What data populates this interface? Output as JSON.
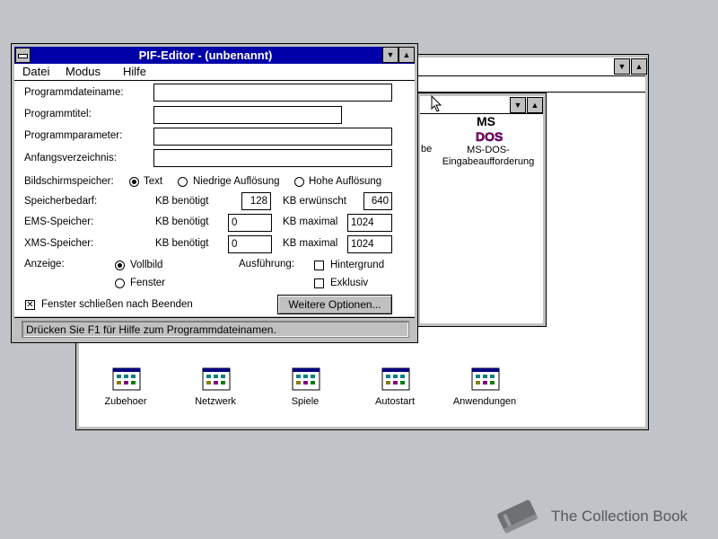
{
  "program_manager": {
    "group_icons": [
      {
        "label": "Zubehoer"
      },
      {
        "label": "Netzwerk"
      },
      {
        "label": "Spiele"
      },
      {
        "label": "Autostart"
      },
      {
        "label": "Anwendungen"
      }
    ]
  },
  "group_window": {
    "partial_text": "be",
    "msdos_icon": {
      "label": "MS-DOS-\nEingabeaufforderung",
      "logo_text_top": "MS",
      "logo_text_bottom": "DOS"
    }
  },
  "pif_editor": {
    "title": "PIF-Editor - (unbenannt)",
    "menu": [
      "Datei",
      "Modus",
      "Hilfe"
    ],
    "fields": {
      "programmdateiname": {
        "label": "Programmdateiname:",
        "value": ""
      },
      "programmtitel": {
        "label": "Programmtitel:",
        "value": ""
      },
      "programmparameter": {
        "label": "Programmparameter:",
        "value": ""
      },
      "anfangsverzeichnis": {
        "label": "Anfangsverzeichnis:",
        "value": ""
      }
    },
    "bildschirm": {
      "label": "Bildschirmspeicher:",
      "options": [
        "Text",
        "Niedrige Auflösung",
        "Hohe Auflösung"
      ],
      "selected": "Text"
    },
    "speicherbedarf": {
      "label": "Speicherbedarf:",
      "needed_label": "KB benötigt",
      "needed": "128",
      "wanted_label": "KB erwünscht",
      "wanted": "640"
    },
    "ems": {
      "label": "EMS-Speicher:",
      "needed_label": "KB benötigt",
      "needed": "0",
      "max_label": "KB maximal",
      "max": "1024"
    },
    "xms": {
      "label": "XMS-Speicher:",
      "needed_label": "KB benötigt",
      "needed": "0",
      "max_label": "KB maximal",
      "max": "1024"
    },
    "anzeige": {
      "label": "Anzeige:",
      "options": [
        "Vollbild",
        "Fenster"
      ],
      "selected": "Vollbild"
    },
    "ausfuehrung": {
      "label": "Ausführung:",
      "options": [
        "Hintergrund",
        "Exklusiv"
      ]
    },
    "close_on_exit": {
      "label": "Fenster schließen nach Beenden",
      "checked": true
    },
    "more_options_button": "Weitere Optionen...",
    "status": "Drücken Sie F1 für Hilfe zum Programmdateinamen."
  },
  "watermark": {
    "text": "The Collection Book"
  },
  "colors": {
    "titlebar_active": "#0000a8",
    "desktop": "#c0c4c8",
    "window_frame": "#c0c0c0"
  }
}
